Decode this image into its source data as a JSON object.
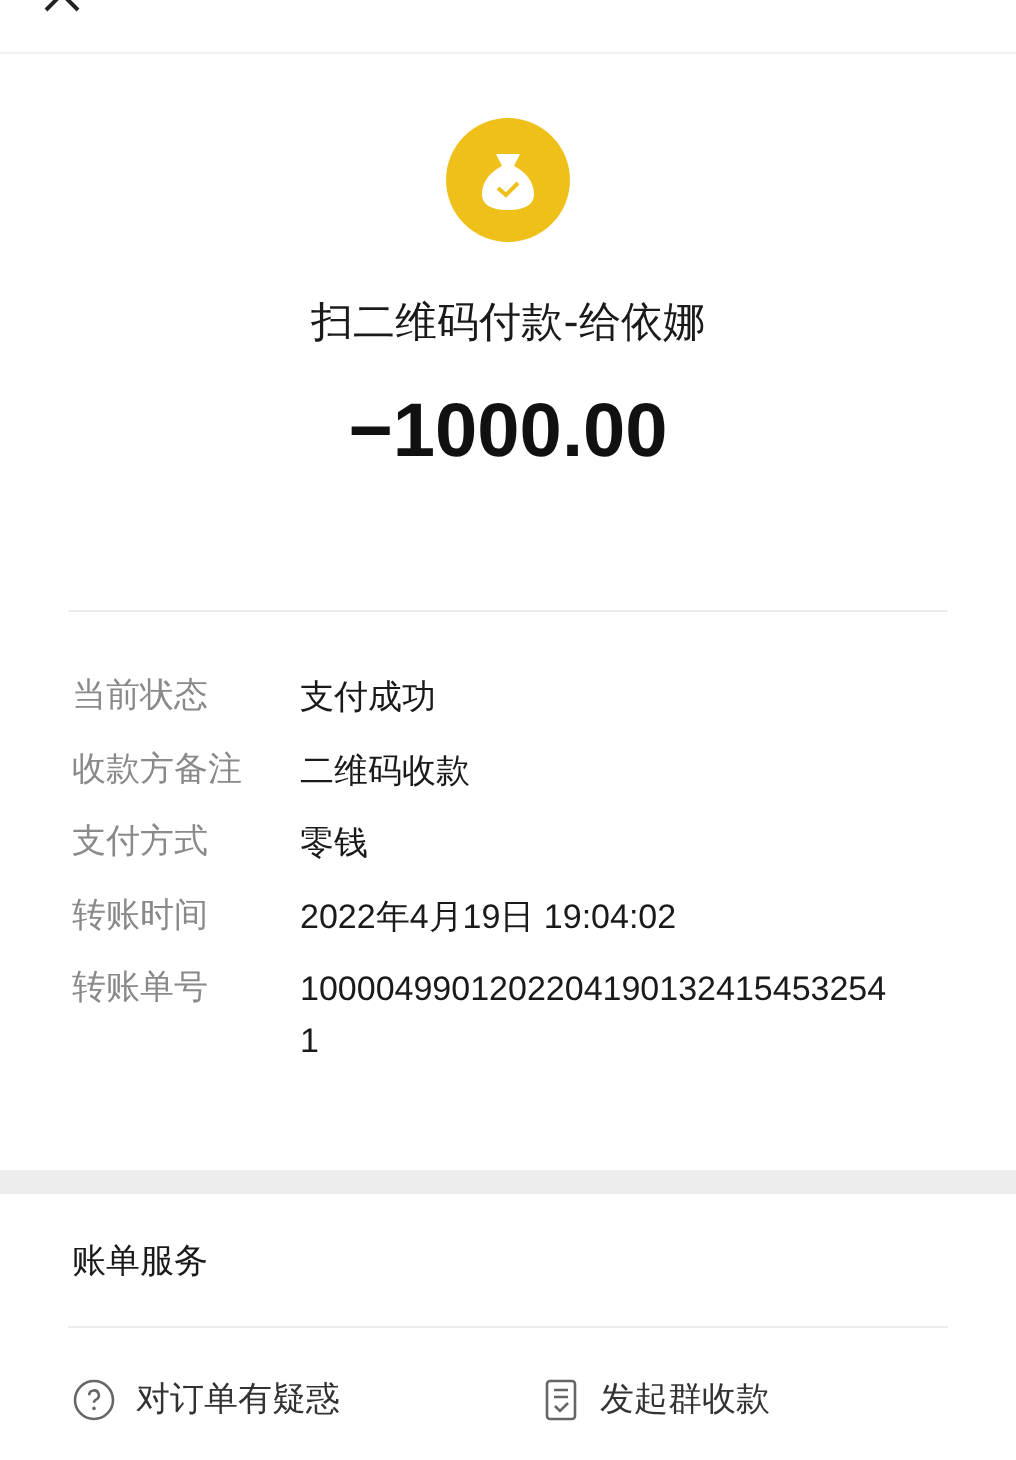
{
  "summary": {
    "title": "扫二维码付款-给依娜",
    "amount": "−1000.00"
  },
  "details": [
    {
      "label": "当前状态",
      "value": "支付成功"
    },
    {
      "label": "收款方备注",
      "value": "二维码收款"
    },
    {
      "label": "支付方式",
      "value": "零钱"
    },
    {
      "label": "转账时间",
      "value": "2022年4月19日 19:04:02"
    },
    {
      "label": "转账单号",
      "value": "10000499012022041901324154532541"
    }
  ],
  "services": {
    "title": "账单服务",
    "actions": [
      {
        "kind": "question",
        "label": "对订单有疑惑"
      },
      {
        "kind": "receipt",
        "label": "发起群收款"
      }
    ]
  }
}
